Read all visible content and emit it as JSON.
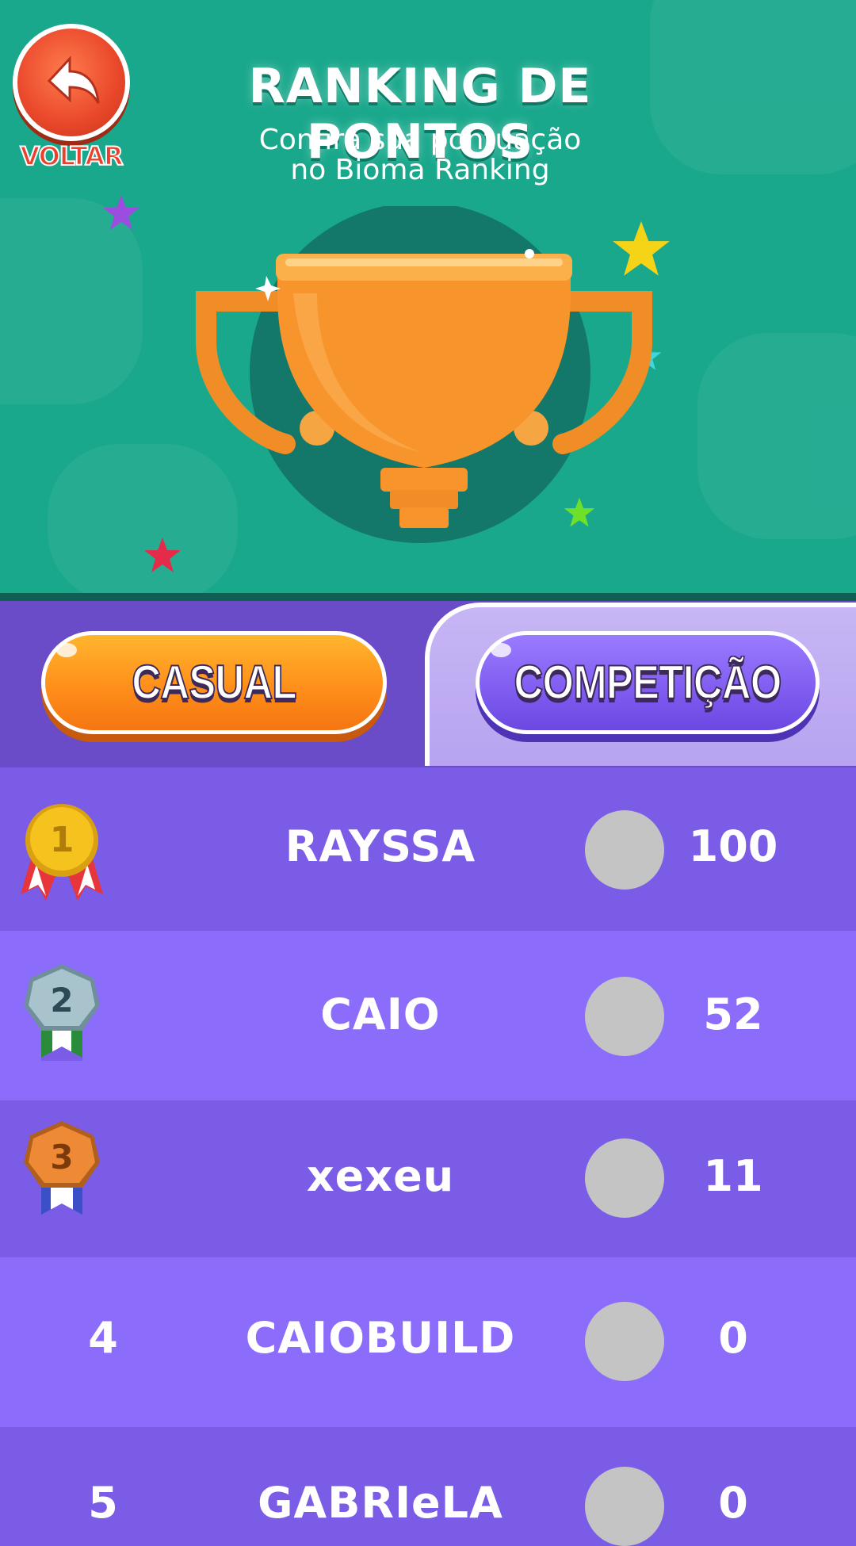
{
  "header": {
    "back_label": "VOLTAR",
    "title": "RANKING DE PONTOS",
    "subtitle": "Confira sua pontuação\nno Bioma Ranking"
  },
  "tabs": [
    {
      "label": "CASUAL",
      "selected": false
    },
    {
      "label": "COMPETIÇÃO",
      "selected": true
    }
  ],
  "ranking": [
    {
      "position": "1",
      "medal": "gold-medal-icon",
      "name": "RAYSSA",
      "score": "100"
    },
    {
      "position": "2",
      "medal": "silver-medal-icon",
      "name": "CAIO",
      "score": "52"
    },
    {
      "position": "3",
      "medal": "bronze-medal-icon",
      "name": "xexeu",
      "score": "11"
    },
    {
      "position": "4",
      "medal": null,
      "name": "CAIOBUILD",
      "score": "0"
    },
    {
      "position": "5",
      "medal": null,
      "name": "GABRIeLA",
      "score": "0"
    }
  ],
  "colors": {
    "header_bg": "#1aa88c",
    "list_dark": "#7b5ce6",
    "list_light": "#8c6cfb",
    "casual_button": "#ff9a1f",
    "competicao_button": "#7f5cf0",
    "back_button": "#e9472a"
  }
}
